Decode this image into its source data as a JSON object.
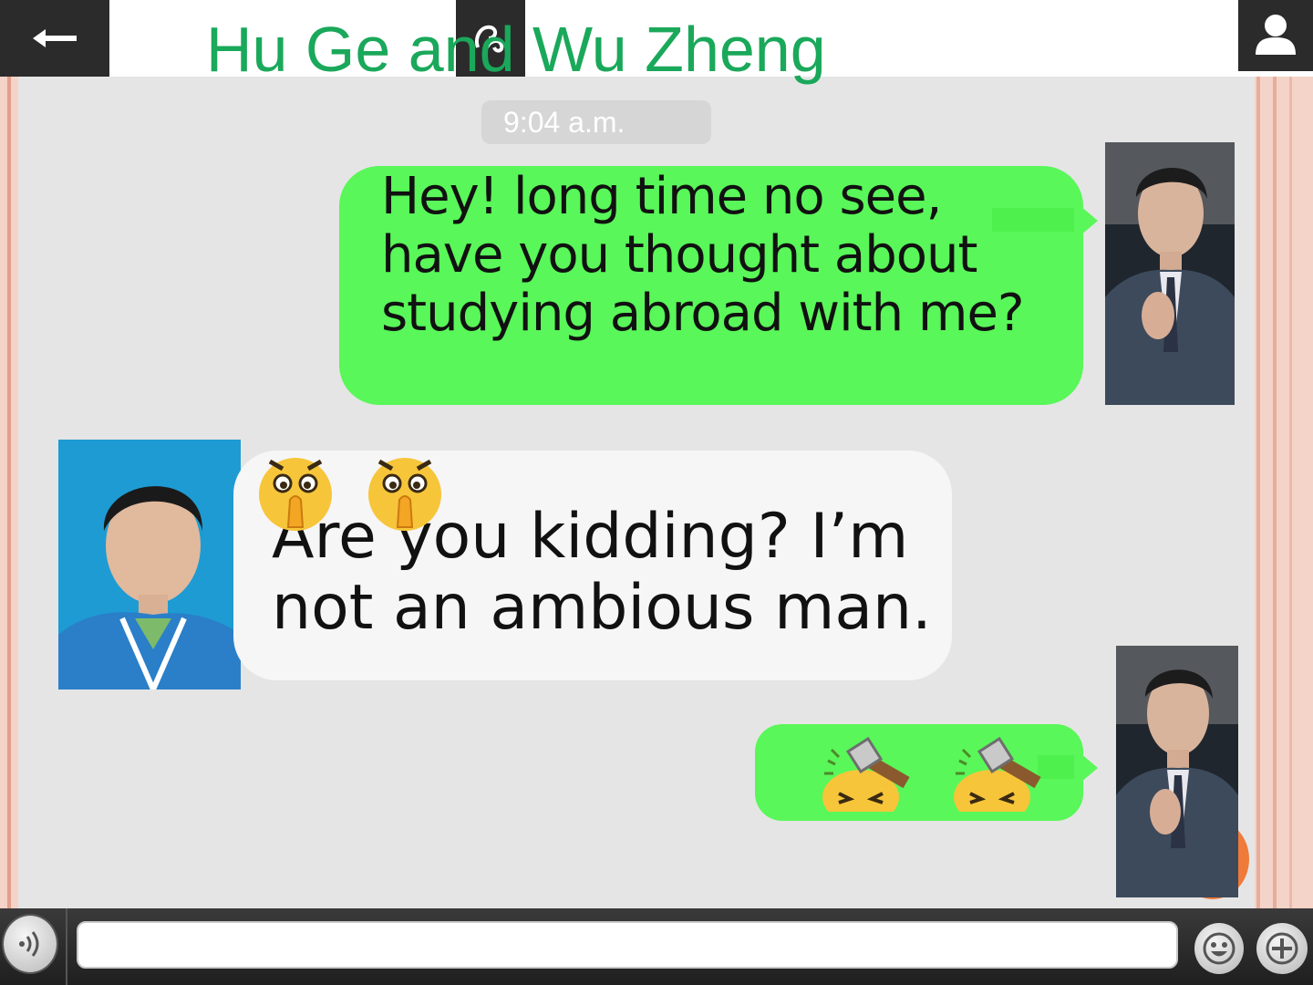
{
  "header": {
    "title": "Hu Ge and Wu Zheng",
    "back_icon": "arrow-left-icon",
    "profile_icon": "user-icon"
  },
  "chat": {
    "timestamp": "9:04 a.m.",
    "messages": [
      {
        "sender": "Hu Ge",
        "side": "right",
        "type": "text",
        "text": "Hey! long time no see, have you thought about studying abroad with me?"
      },
      {
        "sender": "Wu Zheng",
        "side": "left",
        "type": "text",
        "emoji": [
          "shh-emoji",
          "shh-emoji"
        ],
        "text": "Are you kidding? I’m not an ambious man."
      },
      {
        "sender": "Hu Ge",
        "side": "right",
        "type": "emoji",
        "emoji": [
          "hammer-hit-emoji",
          "hammer-hit-emoji"
        ]
      }
    ]
  },
  "input_bar": {
    "voice_icon": "voice-icon",
    "input_value": "",
    "emoji_icon": "smiley-icon",
    "plus_icon": "plus-icon"
  },
  "colors": {
    "title": "#1aa85a",
    "bubble_sent": "#59f759",
    "bubble_received": "#f6f6f6",
    "chat_bg": "#e5e5e5",
    "frame": "#f4d3c8"
  }
}
